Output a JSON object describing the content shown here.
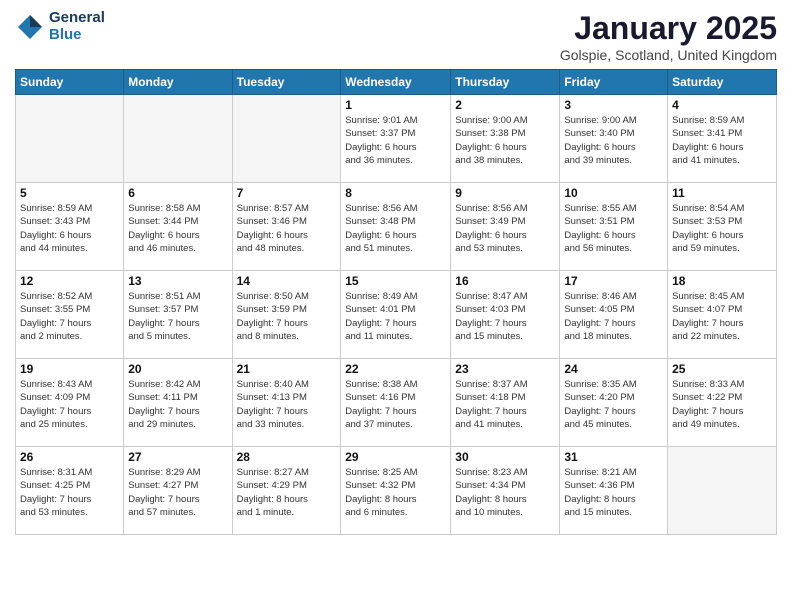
{
  "header": {
    "logo_line1": "General",
    "logo_line2": "Blue",
    "month": "January 2025",
    "location": "Golspie, Scotland, United Kingdom"
  },
  "weekdays": [
    "Sunday",
    "Monday",
    "Tuesday",
    "Wednesday",
    "Thursday",
    "Friday",
    "Saturday"
  ],
  "weeks": [
    [
      {
        "day": "",
        "info": ""
      },
      {
        "day": "",
        "info": ""
      },
      {
        "day": "",
        "info": ""
      },
      {
        "day": "1",
        "info": "Sunrise: 9:01 AM\nSunset: 3:37 PM\nDaylight: 6 hours\nand 36 minutes."
      },
      {
        "day": "2",
        "info": "Sunrise: 9:00 AM\nSunset: 3:38 PM\nDaylight: 6 hours\nand 38 minutes."
      },
      {
        "day": "3",
        "info": "Sunrise: 9:00 AM\nSunset: 3:40 PM\nDaylight: 6 hours\nand 39 minutes."
      },
      {
        "day": "4",
        "info": "Sunrise: 8:59 AM\nSunset: 3:41 PM\nDaylight: 6 hours\nand 41 minutes."
      }
    ],
    [
      {
        "day": "5",
        "info": "Sunrise: 8:59 AM\nSunset: 3:43 PM\nDaylight: 6 hours\nand 44 minutes."
      },
      {
        "day": "6",
        "info": "Sunrise: 8:58 AM\nSunset: 3:44 PM\nDaylight: 6 hours\nand 46 minutes."
      },
      {
        "day": "7",
        "info": "Sunrise: 8:57 AM\nSunset: 3:46 PM\nDaylight: 6 hours\nand 48 minutes."
      },
      {
        "day": "8",
        "info": "Sunrise: 8:56 AM\nSunset: 3:48 PM\nDaylight: 6 hours\nand 51 minutes."
      },
      {
        "day": "9",
        "info": "Sunrise: 8:56 AM\nSunset: 3:49 PM\nDaylight: 6 hours\nand 53 minutes."
      },
      {
        "day": "10",
        "info": "Sunrise: 8:55 AM\nSunset: 3:51 PM\nDaylight: 6 hours\nand 56 minutes."
      },
      {
        "day": "11",
        "info": "Sunrise: 8:54 AM\nSunset: 3:53 PM\nDaylight: 6 hours\nand 59 minutes."
      }
    ],
    [
      {
        "day": "12",
        "info": "Sunrise: 8:52 AM\nSunset: 3:55 PM\nDaylight: 7 hours\nand 2 minutes."
      },
      {
        "day": "13",
        "info": "Sunrise: 8:51 AM\nSunset: 3:57 PM\nDaylight: 7 hours\nand 5 minutes."
      },
      {
        "day": "14",
        "info": "Sunrise: 8:50 AM\nSunset: 3:59 PM\nDaylight: 7 hours\nand 8 minutes."
      },
      {
        "day": "15",
        "info": "Sunrise: 8:49 AM\nSunset: 4:01 PM\nDaylight: 7 hours\nand 11 minutes."
      },
      {
        "day": "16",
        "info": "Sunrise: 8:47 AM\nSunset: 4:03 PM\nDaylight: 7 hours\nand 15 minutes."
      },
      {
        "day": "17",
        "info": "Sunrise: 8:46 AM\nSunset: 4:05 PM\nDaylight: 7 hours\nand 18 minutes."
      },
      {
        "day": "18",
        "info": "Sunrise: 8:45 AM\nSunset: 4:07 PM\nDaylight: 7 hours\nand 22 minutes."
      }
    ],
    [
      {
        "day": "19",
        "info": "Sunrise: 8:43 AM\nSunset: 4:09 PM\nDaylight: 7 hours\nand 25 minutes."
      },
      {
        "day": "20",
        "info": "Sunrise: 8:42 AM\nSunset: 4:11 PM\nDaylight: 7 hours\nand 29 minutes."
      },
      {
        "day": "21",
        "info": "Sunrise: 8:40 AM\nSunset: 4:13 PM\nDaylight: 7 hours\nand 33 minutes."
      },
      {
        "day": "22",
        "info": "Sunrise: 8:38 AM\nSunset: 4:16 PM\nDaylight: 7 hours\nand 37 minutes."
      },
      {
        "day": "23",
        "info": "Sunrise: 8:37 AM\nSunset: 4:18 PM\nDaylight: 7 hours\nand 41 minutes."
      },
      {
        "day": "24",
        "info": "Sunrise: 8:35 AM\nSunset: 4:20 PM\nDaylight: 7 hours\nand 45 minutes."
      },
      {
        "day": "25",
        "info": "Sunrise: 8:33 AM\nSunset: 4:22 PM\nDaylight: 7 hours\nand 49 minutes."
      }
    ],
    [
      {
        "day": "26",
        "info": "Sunrise: 8:31 AM\nSunset: 4:25 PM\nDaylight: 7 hours\nand 53 minutes."
      },
      {
        "day": "27",
        "info": "Sunrise: 8:29 AM\nSunset: 4:27 PM\nDaylight: 7 hours\nand 57 minutes."
      },
      {
        "day": "28",
        "info": "Sunrise: 8:27 AM\nSunset: 4:29 PM\nDaylight: 8 hours\nand 1 minute."
      },
      {
        "day": "29",
        "info": "Sunrise: 8:25 AM\nSunset: 4:32 PM\nDaylight: 8 hours\nand 6 minutes."
      },
      {
        "day": "30",
        "info": "Sunrise: 8:23 AM\nSunset: 4:34 PM\nDaylight: 8 hours\nand 10 minutes."
      },
      {
        "day": "31",
        "info": "Sunrise: 8:21 AM\nSunset: 4:36 PM\nDaylight: 8 hours\nand 15 minutes."
      },
      {
        "day": "",
        "info": ""
      }
    ]
  ]
}
